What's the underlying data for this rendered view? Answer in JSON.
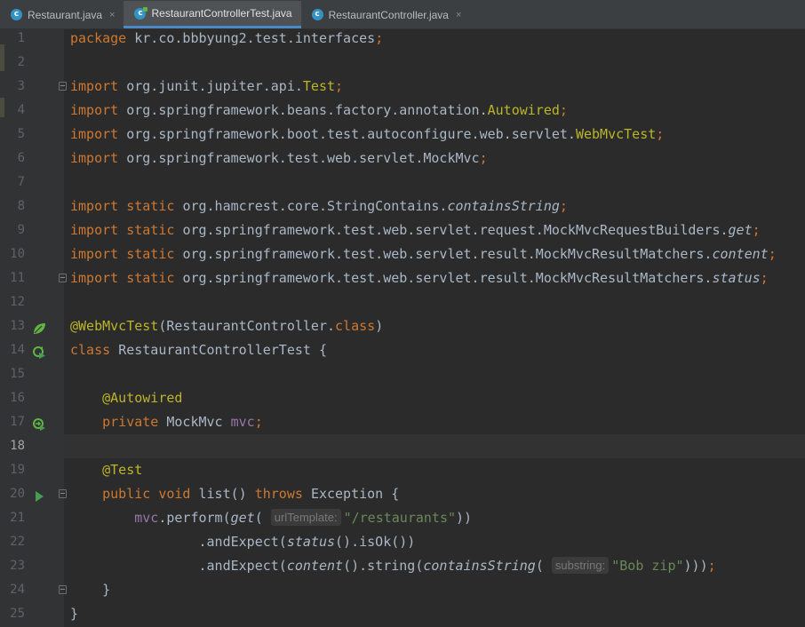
{
  "tabs": [
    {
      "label": "Restaurant.java",
      "icon": "class-icon",
      "active": false,
      "close": "×"
    },
    {
      "label": "RestaurantControllerTest.java",
      "icon": "test-class-icon",
      "active": true,
      "close": ""
    },
    {
      "label": "RestaurantController.java",
      "icon": "class-icon",
      "active": false,
      "close": "×"
    }
  ],
  "tab_icon_glyph": "c",
  "editor": {
    "current_line": 18,
    "lines": [
      {
        "n": "1",
        "tokens": [
          {
            "t": "package ",
            "c": "kw"
          },
          {
            "t": "kr.co.bbbyung2.test.interfaces"
          },
          {
            "t": ";",
            "c": "kw"
          }
        ]
      },
      {
        "n": "2",
        "tokens": []
      },
      {
        "n": "3",
        "fold": true,
        "tokens": [
          {
            "t": "import ",
            "c": "kw"
          },
          {
            "t": "org.junit.jupiter.api."
          },
          {
            "t": "Test",
            "c": "ann"
          },
          {
            "t": ";",
            "c": "kw"
          }
        ]
      },
      {
        "n": "4",
        "tokens": [
          {
            "t": "import ",
            "c": "kw"
          },
          {
            "t": "org.springframework.beans.factory.annotation."
          },
          {
            "t": "Autowired",
            "c": "ann"
          },
          {
            "t": ";",
            "c": "kw"
          }
        ]
      },
      {
        "n": "5",
        "tokens": [
          {
            "t": "import ",
            "c": "kw"
          },
          {
            "t": "org.springframework.boot.test.autoconfigure.web.servlet."
          },
          {
            "t": "WebMvcTest",
            "c": "ann"
          },
          {
            "t": ";",
            "c": "kw"
          }
        ]
      },
      {
        "n": "6",
        "tokens": [
          {
            "t": "import ",
            "c": "kw"
          },
          {
            "t": "org.springframework.test.web.servlet.MockMvc"
          },
          {
            "t": ";",
            "c": "kw"
          }
        ]
      },
      {
        "n": "7",
        "tokens": []
      },
      {
        "n": "8",
        "tokens": [
          {
            "t": "import static ",
            "c": "kw"
          },
          {
            "t": "org.hamcrest.core.StringContains."
          },
          {
            "t": "containsString",
            "c": "it"
          },
          {
            "t": ";",
            "c": "kw"
          }
        ]
      },
      {
        "n": "9",
        "tokens": [
          {
            "t": "import static ",
            "c": "kw"
          },
          {
            "t": "org.springframework.test.web.servlet.request.MockMvcRequestBuilders."
          },
          {
            "t": "get",
            "c": "it"
          },
          {
            "t": ";",
            "c": "kw"
          }
        ]
      },
      {
        "n": "10",
        "tokens": [
          {
            "t": "import static ",
            "c": "kw"
          },
          {
            "t": "org.springframework.test.web.servlet.result.MockMvcResultMatchers."
          },
          {
            "t": "content",
            "c": "it"
          },
          {
            "t": ";",
            "c": "kw"
          }
        ]
      },
      {
        "n": "11",
        "fold": true,
        "tokens": [
          {
            "t": "import static ",
            "c": "kw"
          },
          {
            "t": "org.springframework.test.web.servlet.result.MockMvcResultMatchers."
          },
          {
            "t": "status",
            "c": "it"
          },
          {
            "t": ";",
            "c": "kw"
          }
        ]
      },
      {
        "n": "12",
        "tokens": []
      },
      {
        "n": "13",
        "gicon": "spring-bean-icon",
        "tokens": [
          {
            "t": "@WebMvcTest",
            "c": "ann"
          },
          {
            "t": "(RestaurantController."
          },
          {
            "t": "class",
            "c": "kw"
          },
          {
            "t": ")"
          }
        ]
      },
      {
        "n": "14",
        "gicon": "run-test-class-icon",
        "tokens": [
          {
            "t": "class ",
            "c": "kw"
          },
          {
            "t": "RestaurantControllerTest {"
          }
        ]
      },
      {
        "n": "15",
        "tokens": []
      },
      {
        "n": "16",
        "tokens": [
          {
            "t": "    "
          },
          {
            "t": "@Autowired",
            "c": "ann"
          }
        ]
      },
      {
        "n": "17",
        "gicon": "autowired-bean-icon",
        "tokens": [
          {
            "t": "    "
          },
          {
            "t": "private ",
            "c": "kw"
          },
          {
            "t": "MockMvc "
          },
          {
            "t": "mvc",
            "c": "fld"
          },
          {
            "t": ";",
            "c": "kw"
          }
        ]
      },
      {
        "n": "18",
        "tokens": []
      },
      {
        "n": "19",
        "tokens": [
          {
            "t": "    "
          },
          {
            "t": "@Test",
            "c": "ann"
          }
        ]
      },
      {
        "n": "20",
        "gicon": "run-test-icon",
        "fold": true,
        "tokens": [
          {
            "t": "    "
          },
          {
            "t": "public void ",
            "c": "kw"
          },
          {
            "t": "list() "
          },
          {
            "t": "throws ",
            "c": "kw"
          },
          {
            "t": "Exception {"
          }
        ]
      },
      {
        "n": "21",
        "tokens": [
          {
            "t": "        "
          },
          {
            "t": "mvc",
            "c": "fld"
          },
          {
            "t": ".perform("
          },
          {
            "t": "get",
            "c": "it"
          },
          {
            "t": "( "
          },
          {
            "t": "urlTemplate:",
            "c": "hint"
          },
          {
            "t": "\"/restaurants\"",
            "c": "str"
          },
          {
            "t": "))"
          }
        ]
      },
      {
        "n": "22",
        "tokens": [
          {
            "t": "                .andExpect("
          },
          {
            "t": "status",
            "c": "it"
          },
          {
            "t": "().isOk())"
          }
        ]
      },
      {
        "n": "23",
        "tokens": [
          {
            "t": "                .andExpect("
          },
          {
            "t": "content",
            "c": "it"
          },
          {
            "t": "().string("
          },
          {
            "t": "containsString",
            "c": "it"
          },
          {
            "t": "( "
          },
          {
            "t": "substring:",
            "c": "hint"
          },
          {
            "t": "\"Bob zip\"",
            "c": "str"
          },
          {
            "t": ")))"
          },
          {
            "t": ";",
            "c": "kw"
          }
        ]
      },
      {
        "n": "24",
        "fold": true,
        "tokens": [
          {
            "t": "    }"
          }
        ]
      },
      {
        "n": "25",
        "tokens": [
          {
            "t": "}"
          }
        ]
      }
    ]
  }
}
